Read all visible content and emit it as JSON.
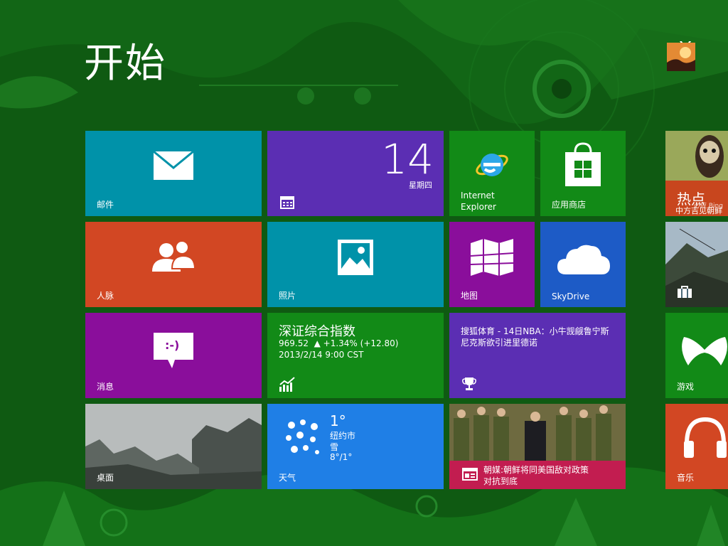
{
  "start": {
    "title": "开始"
  },
  "user": {
    "name": "Y",
    "sub": "H"
  },
  "tiles": {
    "mail": {
      "label": "邮件"
    },
    "calendar": {
      "day": "14",
      "weekday": "星期四"
    },
    "ie": {
      "label_line1": "Internet",
      "label_line2": "Explorer"
    },
    "store": {
      "label": "应用商店"
    },
    "bing": {
      "headline": "热点",
      "caption": "中方吉见朝鲜",
      "extra": "必应 Bing"
    },
    "people": {
      "label": "人脉"
    },
    "photos": {
      "label": "照片"
    },
    "maps": {
      "label": "地图"
    },
    "skydrive": {
      "label": "SkyDrive"
    },
    "travel": {},
    "messaging": {
      "label": "消息",
      "emoticon": ":-)"
    },
    "finance": {
      "title": "深证综合指数",
      "value_line": "969.52  ▲ +1.34% (+12.80)",
      "timestamp": "2013/2/14 9:00 CST"
    },
    "sports": {
      "headline": "搜狐体育 - 14日NBA：小牛觊觎鲁宁斯尼克斯欲引进里德诺"
    },
    "games": {
      "label": "游戏"
    },
    "desktop": {
      "label": "桌面"
    },
    "weather": {
      "temp": "1°",
      "city": "纽约市",
      "condition": "雪",
      "range": "8°/1°",
      "label": "天气"
    },
    "news": {
      "headline_line1": "朝媒:朝鲜将同美国敌对政策",
      "headline_line2": "对抗到底"
    },
    "music": {
      "label": "音乐"
    }
  },
  "colors": {
    "background": "#0f5a12",
    "mail": "#0092a9",
    "calendar": "#5b2eb3",
    "ie": "#128a17",
    "store": "#128a17",
    "bing": "#c8461e",
    "people": "#d24723",
    "photos": "#0092a9",
    "maps": "#8a0e9b",
    "skydrive": "#1d5bc6",
    "messaging": "#8a0e9b",
    "finance": "#128a17",
    "sports": "#5b2eb3",
    "games": "#128a17",
    "weather": "#1f7fe6",
    "news": "#c21d50",
    "music": "#d24723"
  }
}
